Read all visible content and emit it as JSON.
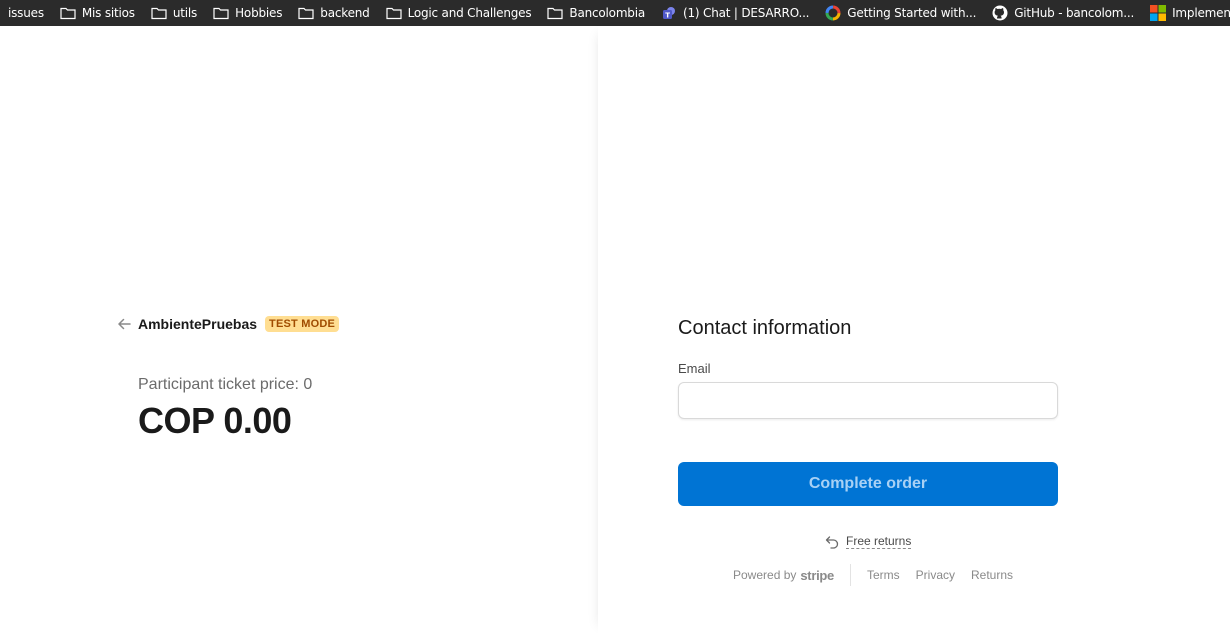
{
  "bookmarks": [
    {
      "label": "issues",
      "icon": "folder-icon"
    },
    {
      "label": "Mis sitios",
      "icon": "folder-icon"
    },
    {
      "label": "utils",
      "icon": "folder-icon"
    },
    {
      "label": "Hobbies",
      "icon": "folder-icon"
    },
    {
      "label": "backend",
      "icon": "folder-icon"
    },
    {
      "label": "Logic and Challenges",
      "icon": "folder-icon"
    },
    {
      "label": "Bancolombia",
      "icon": "folder-icon"
    },
    {
      "label": "(1) Chat | DESARRO...",
      "icon": "teams-icon"
    },
    {
      "label": "Getting Started with...",
      "icon": "colorful-ring-icon"
    },
    {
      "label": "GitHub - bancolom...",
      "icon": "github-icon"
    },
    {
      "label": "Implementación - O...",
      "icon": "microsoft-icon"
    }
  ],
  "merchant": {
    "name": "AmbientePruebas",
    "badge": "TEST MODE"
  },
  "product": {
    "name": "Participant ticket price: 0",
    "price": "COP 0.00"
  },
  "checkout": {
    "contact_title": "Contact information",
    "email_label": "Email",
    "email_value": "",
    "email_placeholder": "",
    "complete_button": "Complete order",
    "free_returns": "Free returns"
  },
  "footer": {
    "powered_by": "Powered by",
    "stripe": "stripe",
    "links": [
      "Terms",
      "Privacy",
      "Returns"
    ]
  },
  "colors": {
    "accent": "#0074d4",
    "badge_bg": "#ffde92",
    "badge_text": "#a04c00",
    "bookmarks_bg": "#2b2b2b"
  }
}
